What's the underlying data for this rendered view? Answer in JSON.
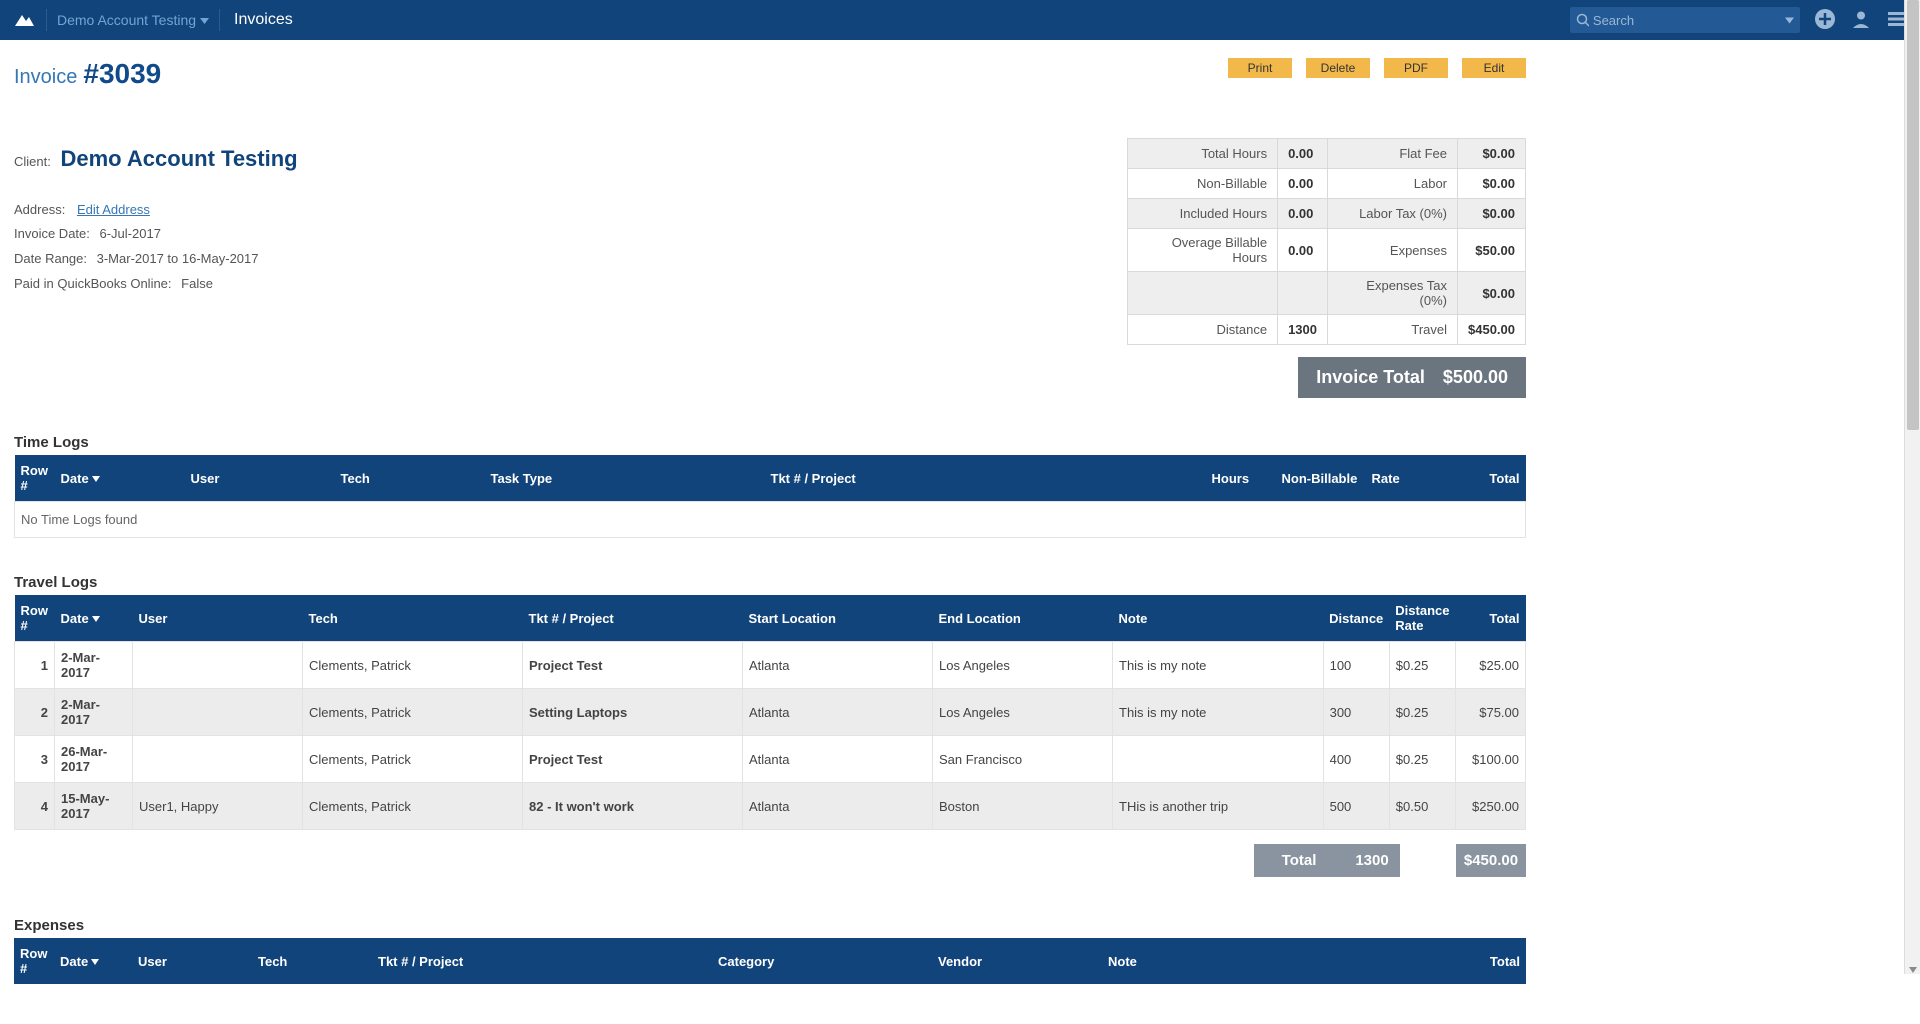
{
  "nav": {
    "account": "Demo Account Testing",
    "crumb": "Invoices",
    "search_placeholder": "Search"
  },
  "header": {
    "title_prefix": "Invoice",
    "title_number": "#3039",
    "actions": {
      "print": "Print",
      "delete": "Delete",
      "pdf": "PDF",
      "edit": "Edit"
    }
  },
  "client": {
    "label": "Client:",
    "name": "Demo Account Testing",
    "address_label": "Address:",
    "edit_address": "Edit Address",
    "invoice_date_label": "Invoice Date:",
    "invoice_date": "6-Jul-2017",
    "date_range_label": "Date Range:",
    "date_range": "3-Mar-2017 to 16-May-2017",
    "qbo_label": "Paid in QuickBooks Online:",
    "qbo": "False"
  },
  "summary": {
    "rows": [
      {
        "l1": "Total Hours",
        "v1": "0.00",
        "l2": "Flat Fee",
        "v2": "$0.00",
        "alt": true
      },
      {
        "l1": "Non-Billable",
        "v1": "0.00",
        "l2": "Labor",
        "v2": "$0.00",
        "alt": false
      },
      {
        "l1": "Included Hours",
        "v1": "0.00",
        "l2": "Labor Tax (0%)",
        "v2": "$0.00",
        "alt": true
      },
      {
        "l1": "Overage Billable Hours",
        "v1": "0.00",
        "l2": "Expenses",
        "v2": "$50.00",
        "alt": false
      },
      {
        "l1": "",
        "v1": "",
        "l2": "Expenses Tax (0%)",
        "v2": "$0.00",
        "alt": true
      },
      {
        "l1": "Distance",
        "v1": "1300",
        "l2": "Travel",
        "v2": "$450.00",
        "alt": false
      }
    ],
    "total_label": "Invoice Total",
    "total_value": "$500.00"
  },
  "time_logs": {
    "title": "Time Logs",
    "columns": [
      "Row #",
      "Date",
      "User",
      "Tech",
      "Task Type",
      "Tkt # / Project",
      "Hours",
      "Non-Billable",
      "Rate",
      "Total"
    ],
    "empty": "No Time Logs found"
  },
  "travel_logs": {
    "title": "Travel Logs",
    "columns": [
      "Row #",
      "Date",
      "User",
      "Tech",
      "Tkt # / Project",
      "Start Location",
      "End Location",
      "Note",
      "Distance",
      "Distance Rate",
      "Total"
    ],
    "rows": [
      {
        "row": "1",
        "date": "2-Mar-2017",
        "user": "",
        "tech": "Clements, Patrick",
        "proj": "Project Test",
        "start": "Atlanta",
        "end": "Los Angeles",
        "note": "This is my note",
        "dist": "100",
        "rate": "$0.25",
        "total": "$25.00"
      },
      {
        "row": "2",
        "date": "2-Mar-2017",
        "user": "",
        "tech": "Clements, Patrick",
        "proj": "Setting Laptops",
        "start": "Atlanta",
        "end": "Los Angeles",
        "note": "This is my note",
        "dist": "300",
        "rate": "$0.25",
        "total": "$75.00"
      },
      {
        "row": "3",
        "date": "26-Mar-2017",
        "user": "",
        "tech": "Clements, Patrick",
        "proj": "Project Test",
        "start": "Atlanta",
        "end": "San Francisco",
        "note": "",
        "dist": "400",
        "rate": "$0.25",
        "total": "$100.00"
      },
      {
        "row": "4",
        "date": "15-May-2017",
        "user": "User1, Happy",
        "tech": "Clements, Patrick",
        "proj": "82 - It won't work",
        "start": "Atlanta",
        "end": "Boston",
        "note": "THis is another trip",
        "dist": "500",
        "rate": "$0.50",
        "total": "$250.00"
      }
    ],
    "total_row": {
      "label": "Total",
      "distance": "1300",
      "amount": "$450.00"
    }
  },
  "expenses": {
    "title": "Expenses",
    "columns": [
      "Row #",
      "Date",
      "User",
      "Tech",
      "Tkt # / Project",
      "Category",
      "Vendor",
      "Note",
      "Total"
    ]
  }
}
